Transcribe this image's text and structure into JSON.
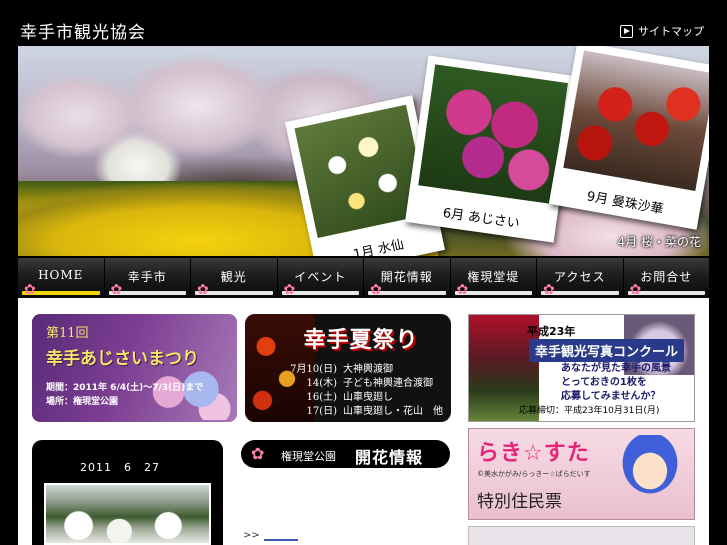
{
  "header": {
    "site_title": "幸手市観光協会",
    "sitemap_label": "サイトマップ"
  },
  "hero": {
    "photos": [
      {
        "caption": "1月 水仙"
      },
      {
        "caption": "6月 あじさい"
      },
      {
        "caption": "9月 曼珠沙華"
      }
    ],
    "caption": "4月 桜・菜の花"
  },
  "nav": {
    "items": [
      {
        "label": "HOME",
        "active": true
      },
      {
        "label": "幸手市"
      },
      {
        "label": "観光"
      },
      {
        "label": "イベント"
      },
      {
        "label": "開花情報"
      },
      {
        "label": "権現堂堤"
      },
      {
        "label": "アクセス"
      },
      {
        "label": "お問合せ"
      }
    ]
  },
  "banners": {
    "ajisai": {
      "edition": "第11回",
      "title": "幸手あじさいまつり",
      "period": "期間：2011年 6/4(土)〜7/3(日)まで",
      "venue": "場所：権現堂公園"
    },
    "natsu": {
      "title": "幸手夏祭り",
      "schedule": [
        {
          "date": "7月10(日)",
          "event": "大神輿渡御"
        },
        {
          "date": "14(木)",
          "event": "子ども神輿連合渡御"
        },
        {
          "date": "16(土)",
          "event": "山車曳廻し"
        },
        {
          "date": "17(日)",
          "event": "山車曳廻し・花山　他"
        }
      ]
    },
    "photo_contest": {
      "year": "平成23年",
      "title": "幸手観光写真コンクール",
      "line1": "あなたが見た幸手の風景",
      "line2": "とっておきの1枚を",
      "line3": "応募してみませんか？",
      "deadline": "応募締切：平成23年10月31日(月)"
    },
    "lucky_star": {
      "logo": "らき☆すた",
      "copyright": "©美水かがみ/らっきー☆ぱらだいす",
      "subtitle": "特別住民票"
    }
  },
  "blog": {
    "date": "2011　6　27"
  },
  "kaika": {
    "sub": "権現堂公園",
    "title": "開花情報",
    "more": ">>"
  },
  "colors": {
    "nav_active_bar": "#f2d600",
    "sakura_icon": "#ff7fa5"
  }
}
